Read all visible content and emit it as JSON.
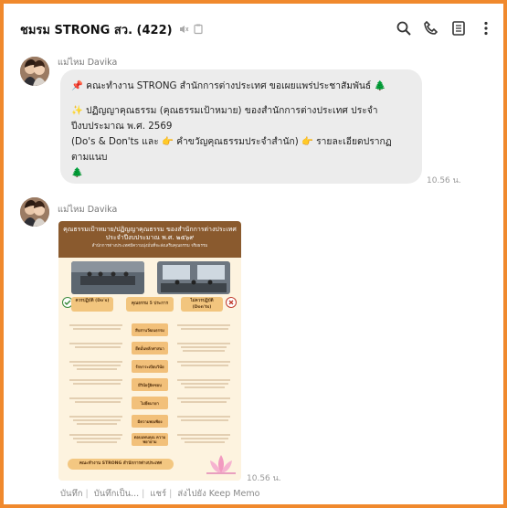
{
  "header": {
    "title": "ชมรม STRONG สว. (422)",
    "icons": [
      "mute-icon",
      "notes-icon",
      "search-icon",
      "phone-icon",
      "list-icon",
      "more-icon"
    ]
  },
  "messages": [
    {
      "sender": "แม่ไหม Davika",
      "lines": [
        "📌 คณะทำงาน STRONG สำนักการต่างประเทศ ขอเผยแพร่ประชาสัมพันธ์ 🌲",
        "✨ ปฏิญญาคุณธรรม (คุณธรรมเป้าหมาย) ของสำนักการต่างประเทศ ประจำปีงบประมาณ พ.ศ. 2569",
        "(Do's & Don'ts และ 👉 คำขวัญคุณธรรมประจำสำนัก) 👉 รายละเอียดปรากฏ ตามแนบ",
        "🌲"
      ],
      "time": "10.56 น."
    },
    {
      "sender": "แม่ไหม Davika",
      "time": "10.56 น.",
      "poster": {
        "title": "คุณธรรมเป้าหมาย/ปฏิญญาคุณธรรม ของสำนักการต่างประเทศ",
        "title2": "ประจำปีงบประมาณ พ.ศ. ๒๕๖๙",
        "subtitle": "สำนักการต่างประเทศมีความมุ่งมั่นที่จะส่งเสริมคุณธรรม จริยธรรม",
        "do_label": "ควรปฏิบัติ (Do's)",
        "virtue_label": "คุณธรรม 5 ประการ",
        "dont_label": "ไม่ควรปฏิบัติ (Don'ts)",
        "virtues": [
          "สืบสานวัฒนธรรม",
          "ยึดมั่นหลักศาสนา",
          "รักษาระเบียบวินัย",
          "มีวินัยรู้ผิดชอบ",
          "ไม่ยึดมายา",
          "มีความพอเพียง",
          "ตอบแทนคุณ ความพยายาม"
        ],
        "footer": "คณะทำงาน STRONG สำนักการต่างประเทศ"
      }
    }
  ],
  "footer_links": [
    "บันทึก",
    "บันทึกเป็น...",
    "แชร์",
    "ส่งไปยัง Keep Memo"
  ],
  "colors": {
    "border": "#f0892d",
    "bubble": "#ececec",
    "poster_header": "#8a5a2e",
    "poster_bg": "#fdf3df"
  }
}
